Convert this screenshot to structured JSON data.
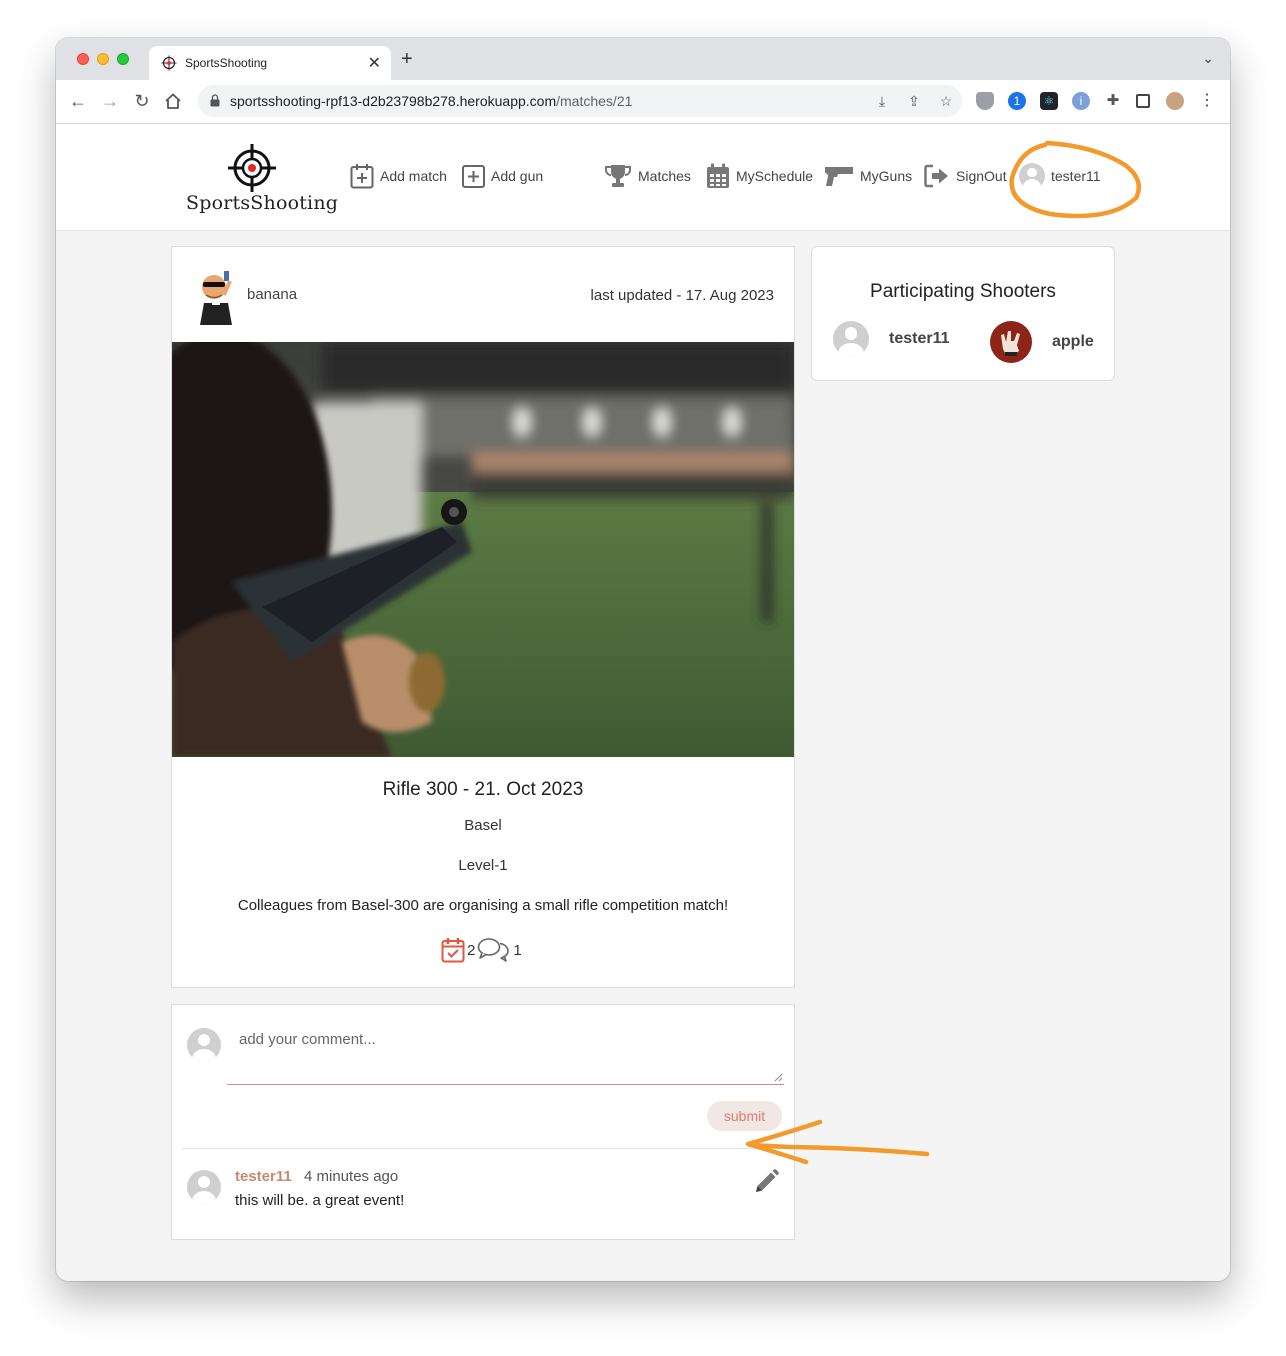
{
  "browser": {
    "tab_title": "SportsShooting",
    "url_host": "sportsshooting-rpf13-d2b23798b278.herokuapp.com",
    "url_path": "/matches/21"
  },
  "header": {
    "logo_text": "SportsShooting",
    "nav": {
      "add_match": "Add match",
      "add_gun": "Add gun",
      "matches": "Matches",
      "my_schedule": "MySchedule",
      "my_guns": "MyGuns",
      "sign_out": "SignOut",
      "user": "tester11"
    }
  },
  "post": {
    "author": "banana",
    "last_updated": "last updated - 17. Aug 2023",
    "title": "Rifle 300 - 21. Oct 2023",
    "location": "Basel",
    "level": "Level-1",
    "description": "Colleagues from Basel-300 are organising a small rifle competition match!",
    "participants_count": "2",
    "comments_count": "1"
  },
  "comment_form": {
    "placeholder": "add your comment...",
    "submit_label": "submit"
  },
  "comments": [
    {
      "user": "tester11",
      "time": "4 minutes ago",
      "text": "this will be. a great event!"
    }
  ],
  "participants": {
    "title": "Participating Shooters",
    "shooters": [
      "tester11",
      "apple"
    ]
  },
  "colors": {
    "accent": "#e0583f",
    "comment_user": "#c88a6e",
    "annotation": "#f39a2c"
  }
}
